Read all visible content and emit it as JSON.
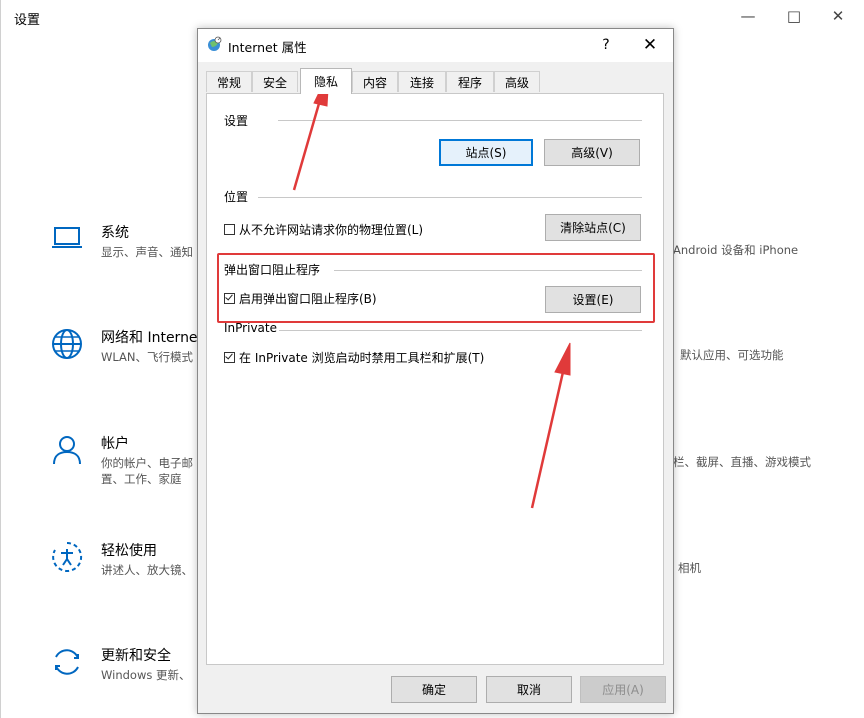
{
  "settings": {
    "title": "设置",
    "categories": [
      {
        "name": "系统",
        "desc": "显示、声音、通知",
        "icon": "laptop-icon"
      },
      {
        "name": "网络和 Interne",
        "desc": "WLAN、飞行模式",
        "icon": "globe-icon"
      },
      {
        "name": "帐户",
        "desc": "你的帐户、电子邮",
        "desc2": "置、工作、家庭",
        "icon": "person-icon"
      },
      {
        "name": "轻松使用",
        "desc": "讲述人、放大镜、",
        "icon": "accessibility-icon"
      },
      {
        "name": "更新和安全",
        "desc": "Windows 更新、",
        "icon": "sync-icon"
      }
    ],
    "right_column": [
      "Android 设备和 iPhone",
      "默认应用、可选功能",
      "栏、截屏、直播、游戏模式",
      "相机"
    ]
  },
  "dialog": {
    "title": "Internet 属性",
    "help": "?",
    "close": "✕",
    "tabs": [
      "常规",
      "安全",
      "隐私",
      "内容",
      "连接",
      "程序",
      "高级"
    ],
    "active_tab": "隐私",
    "sections": {
      "settings_label": "设置",
      "sites_button": "站点(S)",
      "advanced_button": "高级(V)",
      "location_label": "位置",
      "location_checkbox": "从不允许网站请求你的物理位置(L)",
      "location_checked": false,
      "clear_sites_button": "清除站点(C)",
      "popup_label": "弹出窗口阻止程序",
      "popup_checkbox": "启用弹出窗口阻止程序(B)",
      "popup_checked": true,
      "popup_settings_button": "设置(E)",
      "inprivate_label": "InPrivate",
      "inprivate_checkbox": "在 InPrivate 浏览启动时禁用工具栏和扩展(T)",
      "inprivate_checked": true
    },
    "footer": {
      "ok": "确定",
      "cancel": "取消",
      "apply": "应用(A)"
    }
  },
  "colors": {
    "annotation_red": "#e03a3a",
    "accent_blue": "#0078d7",
    "icon_blue": "#0067c0"
  }
}
